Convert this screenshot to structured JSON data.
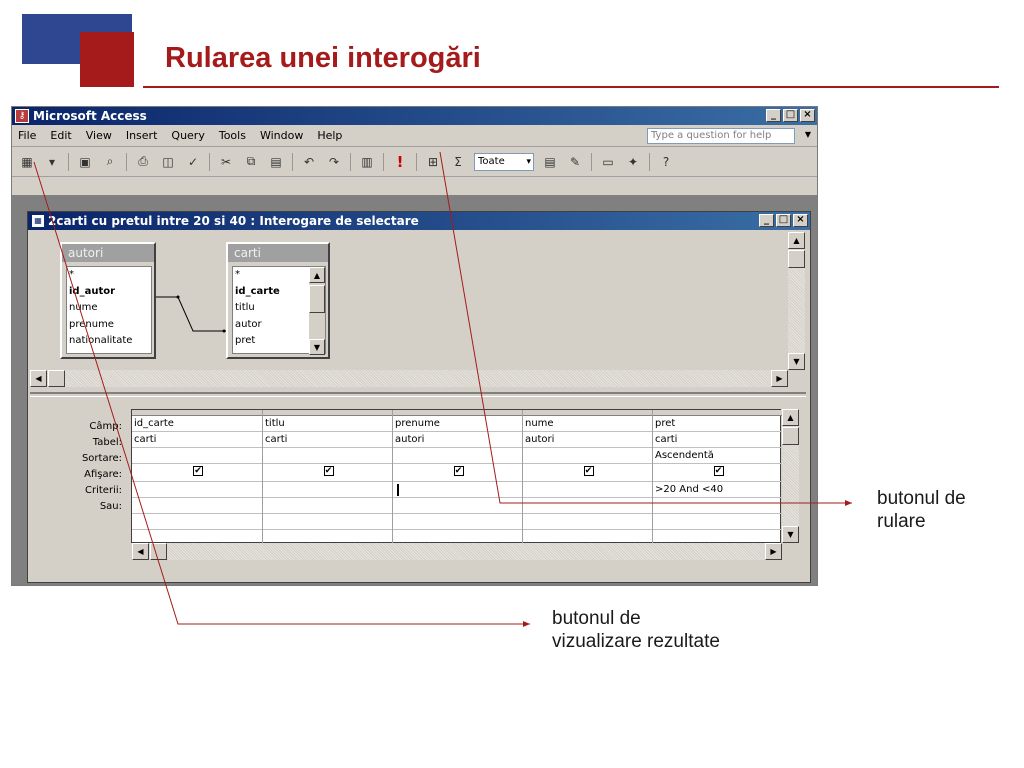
{
  "slide": {
    "title": "Rularea unei interogări"
  },
  "window": {
    "title": "Microsoft Access",
    "controls": [
      "_",
      "□",
      "×"
    ]
  },
  "menu": {
    "items": [
      "File",
      "Edit",
      "View",
      "Insert",
      "Query",
      "Tools",
      "Window",
      "Help"
    ],
    "help_placeholder": "Type a question for help"
  },
  "toolbar": {
    "toate_value": "Toate",
    "sigma": "Σ"
  },
  "query_window": {
    "title": "2carti cu pretul intre 20 si 40 : Interogare de selectare"
  },
  "tables": [
    {
      "name": "autori",
      "fields": [
        "*",
        "id_autor",
        "nume",
        "prenume",
        "nationalitate"
      ]
    },
    {
      "name": "carti",
      "fields": [
        "*",
        "id_carte",
        "titlu",
        "autor",
        "pret"
      ]
    }
  ],
  "grid": {
    "row_labels": [
      "Câmp:",
      "Tabel:",
      "Sortare:",
      "Afişare:",
      "Criterii:",
      "Sau:"
    ],
    "columns": [
      {
        "field": "id_carte",
        "table": "carti",
        "sort": "",
        "show": true,
        "criteria": ""
      },
      {
        "field": "titlu",
        "table": "carti",
        "sort": "",
        "show": true,
        "criteria": ""
      },
      {
        "field": "prenume",
        "table": "autori",
        "sort": "",
        "show": true,
        "criteria": ""
      },
      {
        "field": "nume",
        "table": "autori",
        "sort": "",
        "show": true,
        "criteria": ""
      },
      {
        "field": "pret",
        "table": "carti",
        "sort": "Ascendentă",
        "show": true,
        "criteria": ">20 And <40"
      }
    ]
  },
  "annotations": {
    "run_button": [
      "butonul de",
      "rulare"
    ],
    "view_button": [
      "butonul de",
      "vizualizare rezultate"
    ]
  },
  "colors": {
    "accent_red": "#a51b1b",
    "deco_blue": "#2e4790",
    "titlebar": "#0a246a"
  }
}
